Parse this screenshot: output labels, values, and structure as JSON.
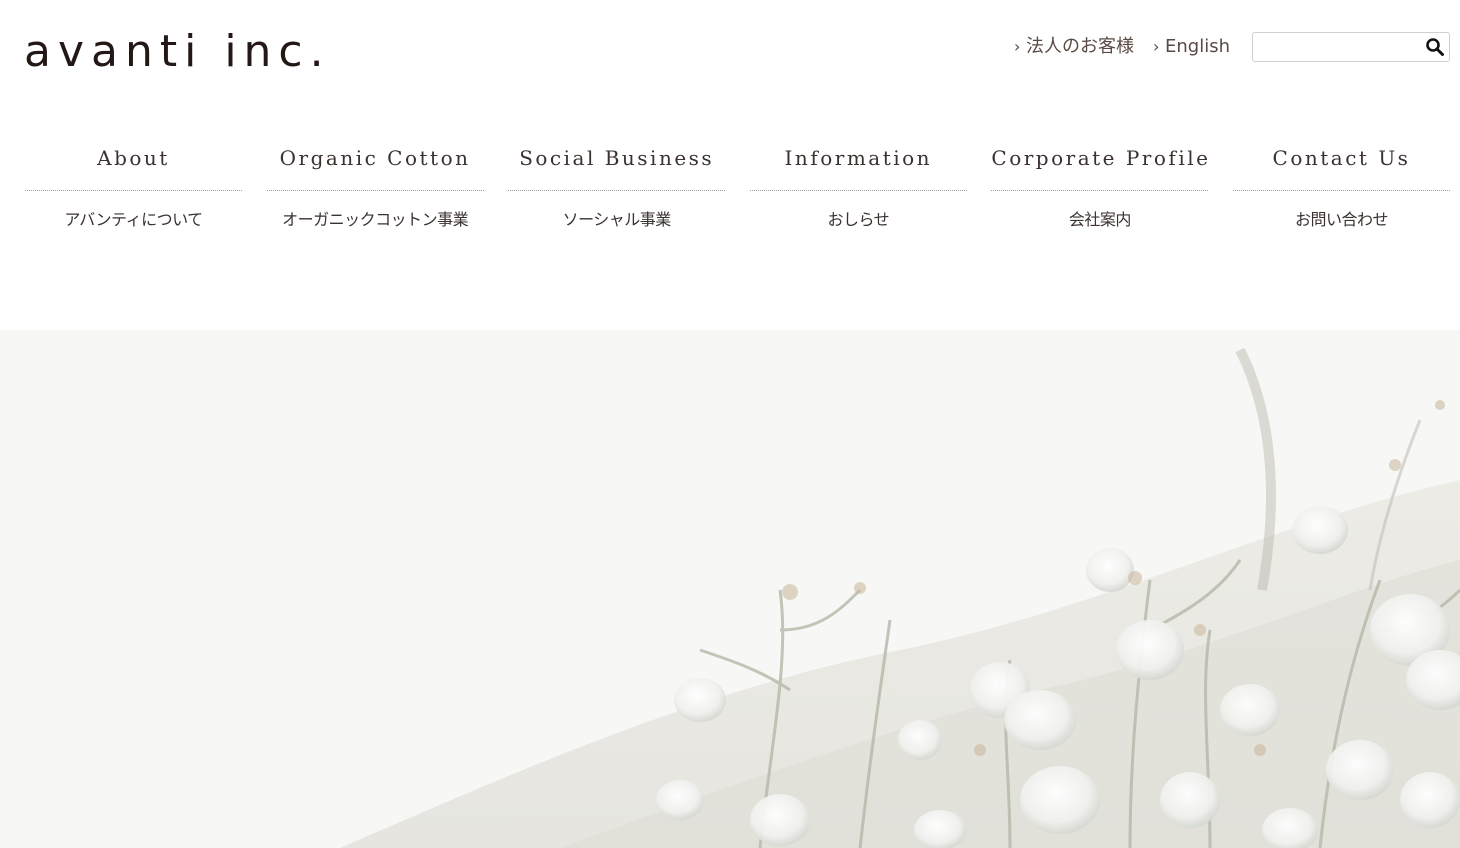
{
  "brand": {
    "logo_text": "avanti inc."
  },
  "utility_nav": {
    "corporate_label": "法人のお客様",
    "english_label": "English"
  },
  "search": {
    "value": "",
    "icon": "search-icon"
  },
  "main_nav": [
    {
      "en": "About",
      "ja": "アバンティについて"
    },
    {
      "en": "Organic Cotton",
      "ja": "オーガニックコットン事業"
    },
    {
      "en": "Social Business",
      "ja": "ソーシャル事業"
    },
    {
      "en": "Information",
      "ja": "おしらせ"
    },
    {
      "en": "Corporate Profile",
      "ja": "会社案内"
    },
    {
      "en": "Contact Us",
      "ja": "お問い合わせ"
    }
  ],
  "colors": {
    "text": "#3b3230",
    "logo": "#231815",
    "divider": "#9a9a9a",
    "hero_background": "#f7f7f6"
  }
}
